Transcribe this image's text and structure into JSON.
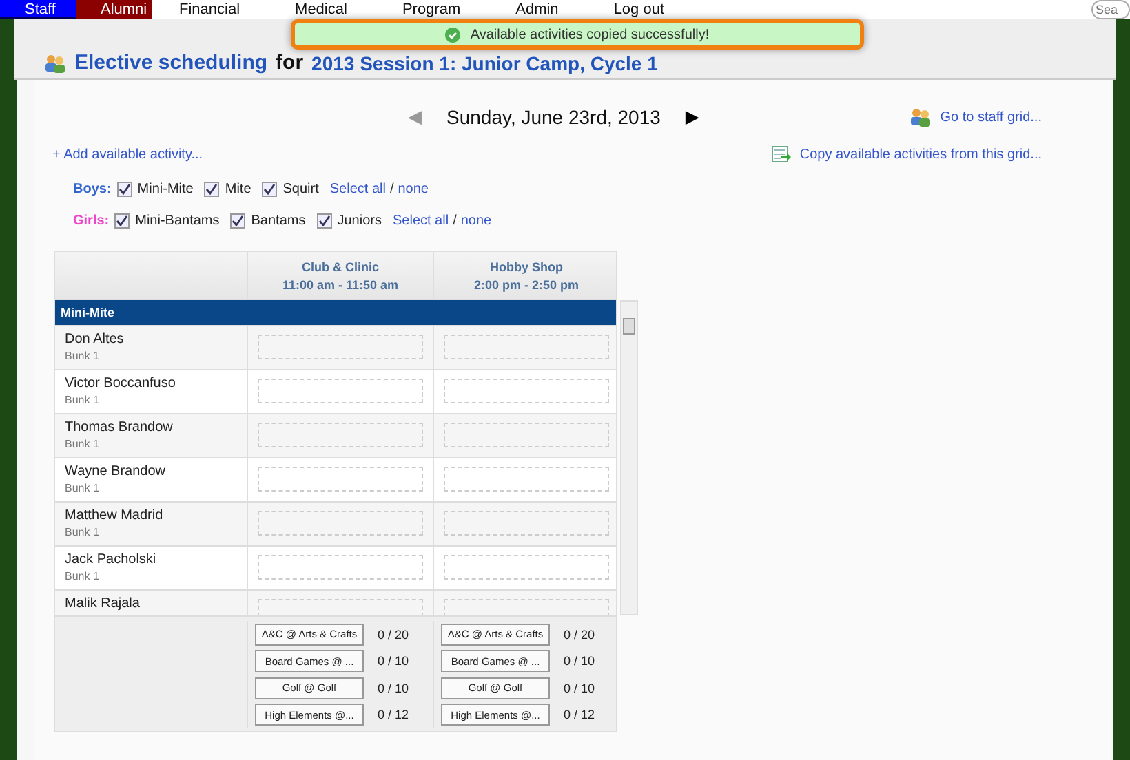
{
  "nav": {
    "tabs": [
      {
        "label": "Staff",
        "selected": true,
        "color": "#0000ff"
      },
      {
        "label": "Alumni",
        "selected": false,
        "color": "#8b0000"
      },
      {
        "label": "Financial",
        "selected": false
      },
      {
        "label": "Medical",
        "selected": false
      },
      {
        "label": "Program",
        "selected": false
      },
      {
        "label": "Admin",
        "selected": false
      },
      {
        "label": "Log out",
        "selected": false
      }
    ],
    "search": {
      "placeholder": "Sea"
    }
  },
  "toast": {
    "message": "Available activities copied successfully!"
  },
  "header": {
    "title": "Elective scheduling",
    "joiner": "for",
    "session": "2013 Session 1: Junior Camp, Cycle 1"
  },
  "date_nav": {
    "prev": "◀",
    "date": "Sunday, June 23rd, 2013",
    "next": "▶",
    "prev_disabled": true
  },
  "links": {
    "staff_grid": "Go to staff grid...",
    "add_activity": "+ Add available activity...",
    "copy": "Copy available activities from this grid..."
  },
  "filters": [
    {
      "label": "Boys:",
      "color": "#3366cc",
      "options": [
        {
          "label": "Mini-Mite",
          "checked": true
        },
        {
          "label": "Mite",
          "checked": true
        },
        {
          "label": "Squirt",
          "checked": true
        }
      ],
      "select_all": "Select all",
      "sep": "/",
      "none": "none"
    },
    {
      "label": "Girls:",
      "color": "#ee44cc",
      "options": [
        {
          "label": "Mini-Bantams",
          "checked": true
        },
        {
          "label": "Bantams",
          "checked": true
        },
        {
          "label": "Juniors",
          "checked": true
        }
      ],
      "select_all": "Select all",
      "sep": "/",
      "none": "none"
    }
  ],
  "table": {
    "columns": [
      {
        "name": "Club & Clinic",
        "time": "11:00 am - 11:50 am"
      },
      {
        "name": "Hobby Shop",
        "time": "2:00 pm - 2:50 pm"
      }
    ],
    "group": "Mini-Mite",
    "rows": [
      {
        "name": "Don Altes",
        "bunk": "Bunk 1"
      },
      {
        "name": "Victor Boccanfuso",
        "bunk": "Bunk 1"
      },
      {
        "name": "Thomas Brandow",
        "bunk": "Bunk 1"
      },
      {
        "name": "Wayne Brandow",
        "bunk": "Bunk 1"
      },
      {
        "name": "Matthew Madrid",
        "bunk": "Bunk 1"
      },
      {
        "name": "Jack Pacholski",
        "bunk": "Bunk 1"
      },
      {
        "name": "Malik Rajala"
      }
    ],
    "activities": [
      [
        {
          "label": "A&C @ Arts & Crafts",
          "count": "0 / 20"
        },
        {
          "label": "Board Games @ ...",
          "count": "0 / 10"
        },
        {
          "label": "Golf @ Golf",
          "count": "0 / 10"
        },
        {
          "label": "High Elements @...",
          "count": "0 / 12"
        }
      ],
      [
        {
          "label": "A&C @ Arts & Crafts",
          "count": "0 / 20"
        },
        {
          "label": "Board Games @ ...",
          "count": "0 / 10"
        },
        {
          "label": "Golf @ Golf",
          "count": "0 / 10"
        },
        {
          "label": "High Elements @...",
          "count": "0 / 12"
        }
      ]
    ]
  }
}
